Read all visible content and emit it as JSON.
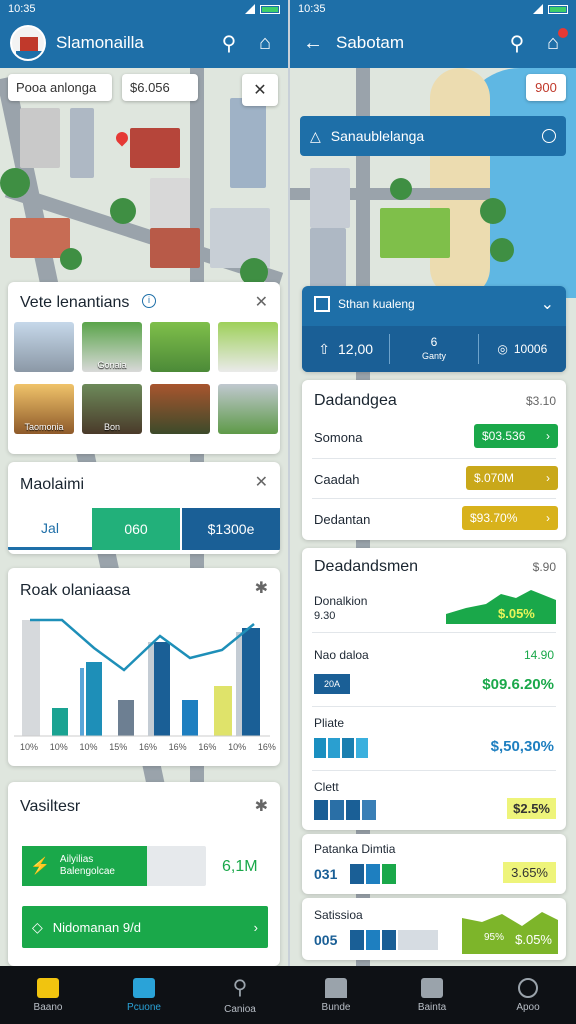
{
  "status": {
    "left_time": "10:35",
    "right_time": "10:35"
  },
  "left": {
    "title": "Slamonailla",
    "search_chip": "Pooa anlonga",
    "price_chip": "$6.056",
    "places_card": {
      "title": "Vete lenantians",
      "thumbs": [
        "",
        "Gonaia",
        "",
        "",
        "Taomonia",
        "Bon",
        "",
        ""
      ]
    },
    "segment_card": {
      "title": "Maolaimi",
      "segments": [
        "Jal",
        "060",
        "$1300e"
      ]
    },
    "chart_card": {
      "title": "Roak olaniaasa",
      "tick_labels": [
        "10%",
        "10%",
        "10%",
        "15%",
        "16%",
        "16%",
        "16%",
        "10%",
        "16%"
      ]
    },
    "vasil_card": {
      "title": "Vasiltesr",
      "row1_label": "Ailyilias",
      "row1_sub": "Balengolcae",
      "row1_value": "6,1M",
      "button_label": "Nidomanan 9/d"
    }
  },
  "right": {
    "title": "Sabotam",
    "top_price": "900",
    "banner_title": "Sanaublelanga",
    "stats_card": {
      "title": "Sthan kualeng",
      "stats": [
        {
          "value": "12,00"
        },
        {
          "value": "6",
          "sub": "Ganty"
        },
        {
          "value": "10006"
        }
      ]
    },
    "list_card": {
      "title": "Dadandgea",
      "corner": "$3.10",
      "rows": [
        {
          "label": "Somona",
          "value": "$03.536",
          "color": "#1aa84a"
        },
        {
          "label": "Caadah",
          "value": "$.070M",
          "color": "#c9a81a"
        },
        {
          "label": "Dedantan",
          "value": "$93.70%",
          "color": "#d8b21c"
        }
      ]
    },
    "detail_card": {
      "title": "Deadandsmen",
      "corner": "$.90",
      "rows": [
        {
          "label": "Donalkion",
          "sub": "9.30",
          "value": "$.05%"
        },
        {
          "label": "Nao daloa",
          "sub": "20A",
          "value": "$09.6.20%",
          "extra": "14.90"
        },
        {
          "label": "Pliate",
          "value": "$,50,30%"
        },
        {
          "label": "Clett",
          "value": "$2.5%"
        }
      ]
    },
    "bottom_cards": [
      {
        "title": "Patanka Dimtia",
        "code": "031",
        "value": "3.65%"
      },
      {
        "title": "Satissioa",
        "code": "005",
        "value": "$.05%",
        "extra": "95%"
      }
    ]
  },
  "nav": [
    {
      "label": "Baano",
      "color": "#f1c40f"
    },
    {
      "label": "Pcuone",
      "color": "#2aa3d8"
    },
    {
      "label": "Canioa",
      "color": "#9aa3ab"
    },
    {
      "label": "Bunde",
      "color": "#9aa3ab"
    },
    {
      "label": "Bainta",
      "color": "#9aa3ab"
    },
    {
      "label": "Apoo",
      "color": "#9aa3ab"
    }
  ]
}
